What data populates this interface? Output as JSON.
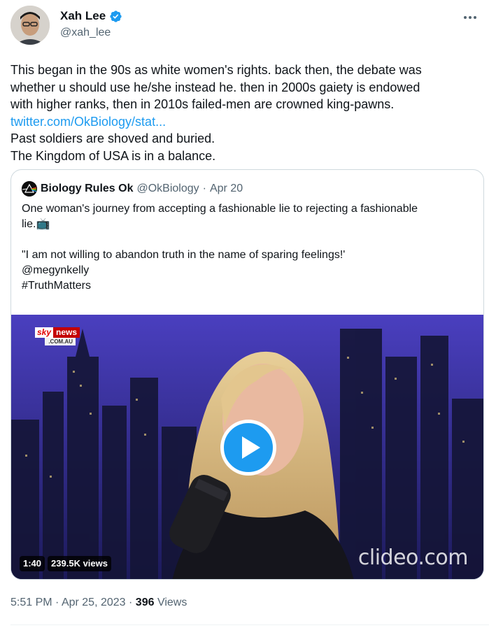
{
  "author": {
    "display_name": "Xah Lee",
    "handle": "@xah_lee",
    "verified_icon": "verified-badge-icon",
    "avatar_icon": "avatar"
  },
  "tweet": {
    "lines": [
      "This began in the 90s as white women's rights. back then, the debate was",
      "whether u should use he/she instead he. then in 2000s gaiety is endowed",
      "with higher ranks, then in 2010s failed-men are crowned king-pawns."
    ],
    "link_text": "twitter.com/OkBiology/stat...",
    "lines_after": [
      "Past soldiers are shoved and buried.",
      "The Kingdom of USA is in a balance."
    ]
  },
  "quote": {
    "display_name": "Biology Rules Ok",
    "handle": "@OkBiology",
    "separator": "·",
    "date": "Apr 20",
    "line1": "One woman's journey from accepting a fashionable lie to rejecting a fashionable",
    "line2": "lie.📺",
    "line3": "\"I am not willing to abandon truth in the name of sparing feelings!'",
    "line4": "@megynkelly",
    "line5": "#TruthMatters",
    "video": {
      "logo_sky": "sky",
      "logo_news": "news",
      "logo_domain": ".COM.AU",
      "duration": "1:40",
      "views": "239.5K views",
      "watermark": "clideo.com"
    }
  },
  "footer": {
    "time": "5:51 PM",
    "sep1": "·",
    "date": "Apr 25, 2023",
    "sep2": "·",
    "views_count": "396",
    "views_label": "Views"
  },
  "colors": {
    "link": "#1d9bf0",
    "secondary_text": "#536471",
    "primary_text": "#0f1419",
    "border": "#cfd9de",
    "play_button": "#1d9bf0"
  }
}
